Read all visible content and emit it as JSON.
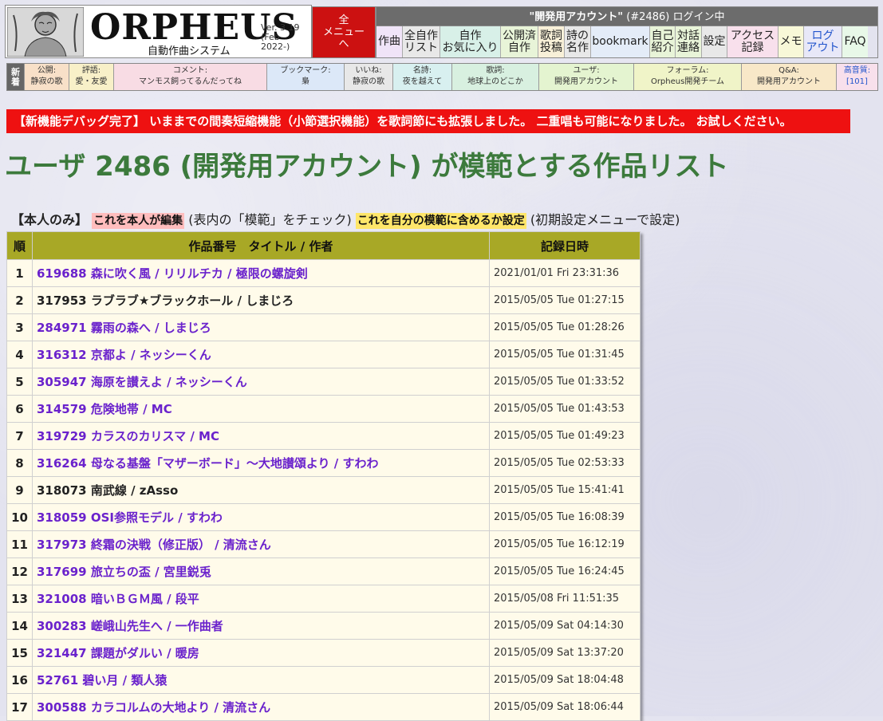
{
  "header": {
    "logo_title": "ORPHEUS",
    "logo_subtitle": "自動作曲システム",
    "version_line1": "Ver. 3.19",
    "version_line2": "(Feb 2022-)",
    "all_menu_line1": "全",
    "all_menu_line2": "メニュー",
    "all_menu_line3": "へ",
    "login_name": "\"開発用アカウント\"",
    "login_rest": " (#2486) ログイン中",
    "menu": [
      {
        "l1": "作曲",
        "l2": "",
        "bg": "#f0e4f8",
        "w": 32,
        "blue": false
      },
      {
        "l1": "全自作",
        "l2": "リスト",
        "bg": "#e8e8e8",
        "w": 47,
        "blue": false
      },
      {
        "l1": "自作",
        "l2": "お気に入り",
        "bg": "#d8f0e8",
        "w": 76,
        "blue": false
      },
      {
        "l1": "公開済",
        "l2": "自作",
        "bg": "#e8f4d8",
        "w": 47,
        "blue": false
      },
      {
        "l1": "歌詞",
        "l2": "投稿",
        "bg": "#f8f0d8",
        "w": 33,
        "blue": false
      },
      {
        "l1": "詩の",
        "l2": "名作",
        "bg": "#e8e8e8",
        "w": 33,
        "blue": false
      },
      {
        "l1": "bookmark",
        "l2": "",
        "bg": "#e4ecf8",
        "w": 74,
        "blue": false
      },
      {
        "l1": "自己",
        "l2": "紹介",
        "bg": "#e8f4d8",
        "w": 32,
        "blue": false
      },
      {
        "l1": "対話",
        "l2": "連絡",
        "bg": "#e8f4d8",
        "w": 33,
        "blue": false
      },
      {
        "l1": "設定",
        "l2": "",
        "bg": "#e8e8e8",
        "w": 32,
        "blue": false
      },
      {
        "l1": "アクセス",
        "l2": "記録",
        "bg": "#f8e0ec",
        "w": 64,
        "blue": false
      },
      {
        "l1": "メモ",
        "l2": "",
        "bg": "#f8f8d8",
        "w": 32,
        "blue": false
      },
      {
        "l1": "ログ",
        "l2": "アウト",
        "bg": "#e8e8f8",
        "w": 48,
        "blue": true
      },
      {
        "l1": "FAQ",
        "l2": "",
        "bg": "#e8f8e8",
        "w": 33,
        "blue": false
      }
    ]
  },
  "news": {
    "tag": "新着",
    "items": [
      {
        "k": "公開:",
        "v": "静寂の歌",
        "bg": "#f8e0c8",
        "w": 54,
        "blue": false
      },
      {
        "k": "評語:",
        "v": "愛・友愛",
        "bg": "#f8f0c8",
        "w": 54,
        "blue": false
      },
      {
        "k": "コメント:",
        "v": "マンモス飼ってるんだってね",
        "bg": "#f8dce4",
        "w": 190,
        "blue": false
      },
      {
        "k": "ブックマーク:",
        "v": "梟",
        "bg": "#dce8f8",
        "w": 95,
        "blue": false
      },
      {
        "k": "いいね:",
        "v": "静寂の歌",
        "bg": "#e8e8e8",
        "w": 59,
        "blue": false
      },
      {
        "k": "名詩:",
        "v": "夜を越えて",
        "bg": "#d8f0f0",
        "w": 72,
        "blue": false
      },
      {
        "k": "歌詞:",
        "v": "地球上のどこか",
        "bg": "#d8f0e0",
        "w": 107,
        "blue": false
      },
      {
        "k": "ユーザ:",
        "v": "開発用アカウント",
        "bg": "#e4f4d0",
        "w": 117,
        "blue": false
      },
      {
        "k": "フォーラム:",
        "v": "Orpheus開発チーム",
        "bg": "#f0f4c8",
        "w": 133,
        "blue": false
      },
      {
        "k": "Q&A:",
        "v": "開発用アカウント",
        "bg": "#f8e8c8",
        "w": 117,
        "blue": false
      },
      {
        "k": "高音質:",
        "v": "[101]",
        "bg": "#f8e0ec",
        "w": 50,
        "blue": true
      }
    ]
  },
  "banner": "【新機能デバッグ完了】 いままでの間奏短縮機能（小節選択機能）を歌詞節にも拡張しました。 二重唱も可能になりました。 お試しください。",
  "page_title": "ユーザ 2486 (開発用アカウント) が模範とする作品リスト",
  "controls": {
    "own_only": "【本人のみ】",
    "edit_button": "これを本人が編集",
    "edit_note": "(表内の「模範」をチェック)",
    "include_button": "これを自分の模範に含めるか設定",
    "include_note": "(初期設定メニューで設定)"
  },
  "table": {
    "headers": {
      "no": "順",
      "title": "作品番号　タイトル / 作者",
      "date": "記録日時"
    },
    "rows": [
      {
        "no": "1",
        "title": "619688 森に吹く風 / リリルチカ / 極限の螺旋剣",
        "date": "2021/01/01 Fri 23:31:36",
        "visited": true
      },
      {
        "no": "2",
        "title": "317953 ラブラブ★ブラックホール / しまじろ",
        "date": "2015/05/05 Tue 01:27:15",
        "visited": false
      },
      {
        "no": "3",
        "title": "284971 霧雨の森へ / しまじろ",
        "date": "2015/05/05 Tue 01:28:26",
        "visited": true
      },
      {
        "no": "4",
        "title": "316312 京都よ / ネッシーくん",
        "date": "2015/05/05 Tue 01:31:45",
        "visited": true
      },
      {
        "no": "5",
        "title": "305947 海原を讃えよ / ネッシーくん",
        "date": "2015/05/05 Tue 01:33:52",
        "visited": true
      },
      {
        "no": "6",
        "title": "314579 危険地帯 / MC",
        "date": "2015/05/05 Tue 01:43:53",
        "visited": true
      },
      {
        "no": "7",
        "title": "319729 カラスのカリスマ / MC",
        "date": "2015/05/05 Tue 01:49:23",
        "visited": true
      },
      {
        "no": "8",
        "title": "316264 母なる基盤「マザーボード」～大地讃頌より / すわわ",
        "date": "2015/05/05 Tue 02:53:33",
        "visited": true
      },
      {
        "no": "9",
        "title": "318073 南武線 / zAsso",
        "date": "2015/05/05 Tue 15:41:41",
        "visited": false
      },
      {
        "no": "10",
        "title": "318059 OSI参照モデル / すわわ",
        "date": "2015/05/05 Tue 16:08:39",
        "visited": true
      },
      {
        "no": "11",
        "title": "317973 終霜の決戦（修正版） / 清流さん",
        "date": "2015/05/05 Tue 16:12:19",
        "visited": true
      },
      {
        "no": "12",
        "title": "317699 旅立ちの盃 / 宮里鋭兎",
        "date": "2015/05/05 Tue 16:24:45",
        "visited": true
      },
      {
        "no": "13",
        "title": "321008 暗いＢＧＭ風 / 段平",
        "date": "2015/05/08 Fri 11:51:35",
        "visited": true
      },
      {
        "no": "14",
        "title": "300283 嵯峨山先生へ / 一作曲者",
        "date": "2015/05/09 Sat 04:14:30",
        "visited": true
      },
      {
        "no": "15",
        "title": "321447 課題がダルい / 暖房",
        "date": "2015/05/09 Sat 13:37:20",
        "visited": true
      },
      {
        "no": "16",
        "title": "52761 碧い月 / 類人猿",
        "date": "2015/05/09 Sat 18:04:48",
        "visited": true
      },
      {
        "no": "17",
        "title": "300588 カラコルムの大地より / 清流さん",
        "date": "2015/05/09 Sat 18:06:44",
        "visited": true
      }
    ]
  }
}
